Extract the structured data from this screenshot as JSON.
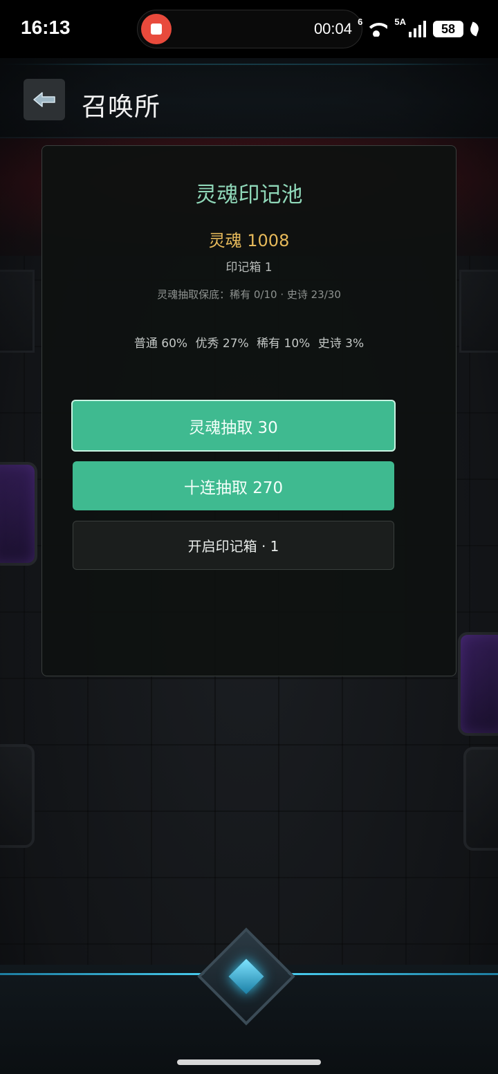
{
  "status_bar": {
    "time": "16:13",
    "recording_time": "00:04",
    "wifi_label": "6",
    "network_label": "5A",
    "battery": "58"
  },
  "header": {
    "title": "召唤所"
  },
  "pool": {
    "title": "灵魂印记池",
    "soul": "灵魂 1008",
    "mark_box": "印记箱 1",
    "pity": "灵魂抽取保底：稀有 0/10 · 史诗 23/30",
    "rates": [
      "普通 60%",
      "优秀 27%",
      "稀有 10%",
      "史诗 3%"
    ]
  },
  "buttons": {
    "single": "灵魂抽取 30",
    "ten": "十连抽取 270",
    "open": "开启印记箱 · 1"
  },
  "colors": {
    "accent": "#3fba90",
    "title": "#8fd7b8",
    "gold": "#e6b95a"
  }
}
